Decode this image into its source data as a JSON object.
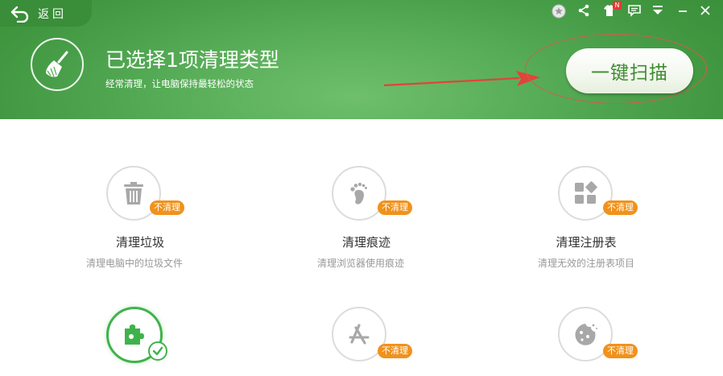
{
  "header": {
    "back_label": "返回",
    "title": "已选择1项清理类型",
    "subtitle": "经常清理，让电脑保持最轻松的状态",
    "scan_button": "一键扫描",
    "notification_badge": "N"
  },
  "colors": {
    "header_green": "#4fa64f",
    "badge_orange": "#f0921c",
    "check_green": "#3fb34b",
    "annotation_red": "#e0443a"
  },
  "items": [
    {
      "title": "清理垃圾",
      "desc": "清理电脑中的垃圾文件",
      "badge": "不清理",
      "icon": "trash-icon",
      "selected": false
    },
    {
      "title": "清理痕迹",
      "desc": "清理浏览器使用痕迹",
      "badge": "不清理",
      "icon": "footprint-icon",
      "selected": false
    },
    {
      "title": "清理注册表",
      "desc": "清理无效的注册表项目",
      "badge": "不清理",
      "icon": "registry-icon",
      "selected": false
    },
    {
      "title": "",
      "desc": "",
      "badge": "",
      "icon": "puzzle-icon",
      "selected": true
    },
    {
      "title": "",
      "desc": "",
      "badge": "不清理",
      "icon": "app-store-icon",
      "selected": false
    },
    {
      "title": "",
      "desc": "",
      "badge": "不清理",
      "icon": "cookie-icon",
      "selected": false
    }
  ]
}
